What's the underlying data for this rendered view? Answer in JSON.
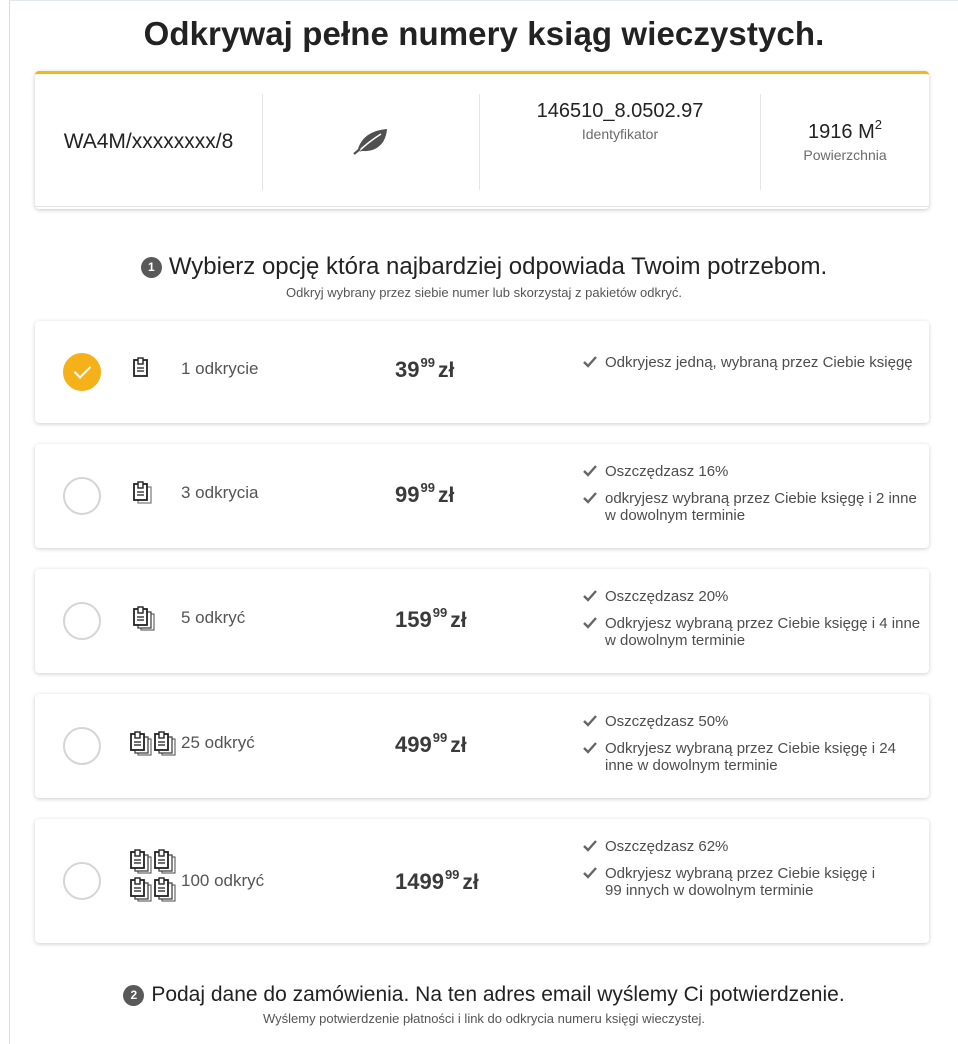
{
  "header": {
    "title_pre": "Odkrywaj",
    "title_bold": "pełne numery",
    "title_post": "ksiąg wieczystych."
  },
  "parcel": {
    "kw_number": "WA4M/xxxxxxxx/8",
    "identifier_value": "146510_8.0502.97",
    "identifier_label": "Identyfikator",
    "area_value": "1916 M",
    "area_exp": "2",
    "area_label": "Powierzchnia"
  },
  "step1": {
    "number": "1",
    "title": "Wybierz opcję która najbardziej odpowiada Twoim potrzebom.",
    "subtitle": "Odkryj wybrany przez siebie numer lub skorzystaj z pakietów odkryć."
  },
  "options": [
    {
      "name": "1 odkrycie",
      "price_main": "39",
      "price_cents": "99",
      "currency": "zł",
      "selected": true,
      "benefits": [
        "Odkryjesz jedną, wybraną przez Ciebie księgę"
      ]
    },
    {
      "name": "3 odkrycia",
      "price_main": "99",
      "price_cents": "99",
      "currency": "zł",
      "selected": false,
      "benefits": [
        "Oszczędzasz 16%",
        "odkryjesz wybraną przez Ciebie księgę i 2 inne w dowolnym terminie"
      ]
    },
    {
      "name": "5 odkryć",
      "price_main": "159",
      "price_cents": "99",
      "currency": "zł",
      "selected": false,
      "benefits": [
        "Oszczędzasz 20%",
        "Odkryjesz wybraną przez Ciebie księgę i 4 inne w dowolnym terminie"
      ]
    },
    {
      "name": "25 odkryć",
      "price_main": "499",
      "price_cents": "99",
      "currency": "zł",
      "selected": false,
      "benefits": [
        "Oszczędzasz 50%",
        "Odkryjesz wybraną przez Ciebie księgę i 24 inne w dowolnym terminie"
      ]
    },
    {
      "name": "100 odkryć",
      "price_main": "1499",
      "price_cents": "99",
      "currency": "zł",
      "selected": false,
      "benefits": [
        "Oszczędzasz 62%",
        "Odkryjesz wybraną przez Ciebie księgę i 99 innych w dowolnym terminie"
      ]
    }
  ],
  "step2": {
    "number": "2",
    "title": "Podaj dane do zamówienia. Na ten adres email wyślemy Ci potwierdzenie.",
    "subtitle": "Wyślemy potwierdzenie płatności i link do odkrycia numeru księgi wieczystej."
  },
  "colors": {
    "accent": "#f5b11a",
    "accent_border": "#f2b817",
    "step_badge": "#595959"
  },
  "icons": {
    "leaf": "leaf-icon",
    "check": "check-icon",
    "document": "document-stack-icon"
  }
}
